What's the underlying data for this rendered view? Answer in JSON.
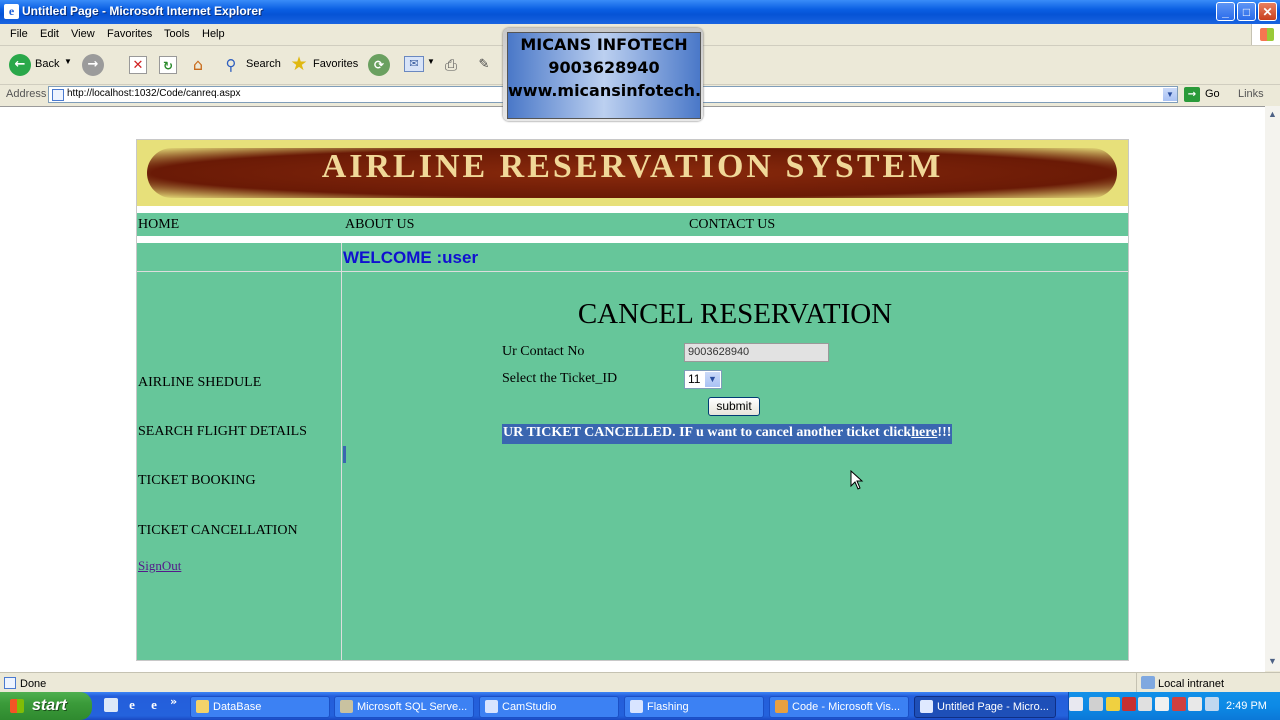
{
  "window": {
    "title": "Untitled Page - Microsoft Internet Explorer",
    "controls": {
      "minimize": "_",
      "maximize": "□",
      "close": "✕"
    }
  },
  "menu": [
    "File",
    "Edit",
    "View",
    "Favorites",
    "Tools",
    "Help"
  ],
  "toolbar": {
    "back_label": "Back",
    "search_label": "Search",
    "favorites_label": "Favorites"
  },
  "address": {
    "label": "Address",
    "url": "http://localhost:1032/Code/canreq.aspx",
    "go_label": "Go",
    "links_label": "Links"
  },
  "watermark": {
    "line1": "MICANS INFOTECH",
    "line2": "9003628940",
    "line3": "www.micansinfotech.co"
  },
  "site": {
    "banner_title": "AIRLINE RESERVATION SYSTEM",
    "nav": {
      "home": "HOME",
      "about": "ABOUT US",
      "contact": "CONTACT US"
    },
    "welcome": "WELCOME :user",
    "sidebar": {
      "schedule": "AIRLINE SHEDULE",
      "search": "SEARCH FLIGHT DETAILS",
      "booking": "TICKET BOOKING",
      "cancellation": "TICKET CANCELLATION",
      "signout": "SignOut"
    },
    "form": {
      "title": "CANCEL RESERVATION",
      "contact_label": "Ur Contact No",
      "contact_value": "9003628940",
      "ticket_label": "Select the Ticket_ID",
      "ticket_value": "11",
      "submit_label": "submit",
      "message_text": "UR TICKET CANCELLED. IF u want to cancel another ticket click",
      "message_link": "here",
      "message_suffix": "!!!"
    }
  },
  "status": {
    "left": "Done",
    "zone": "Local intranet"
  },
  "taskbar": {
    "start": "start",
    "tasks": [
      "DataBase",
      "Microsoft SQL Serve...",
      "CamStudio",
      "Flashing",
      "Code - Microsoft Vis...",
      "Untitled Page - Micro..."
    ],
    "clock": "2:49 PM"
  }
}
